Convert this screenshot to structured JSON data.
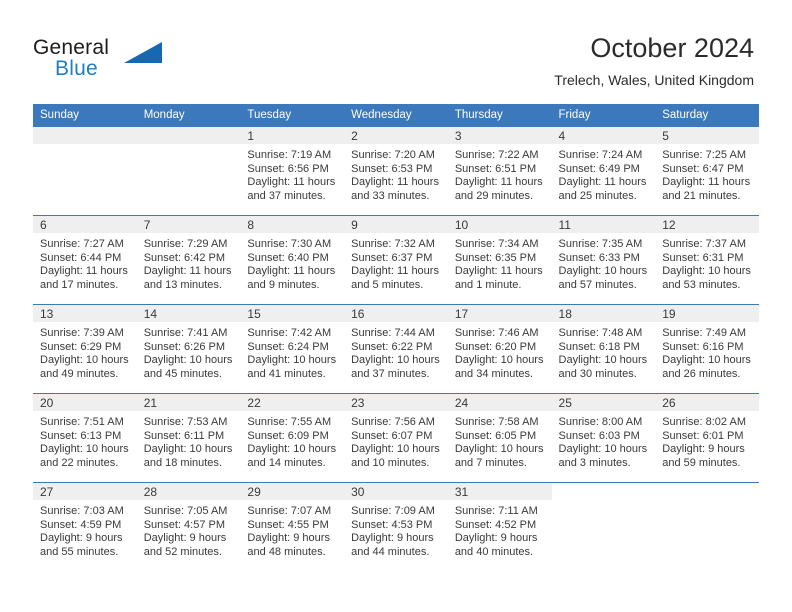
{
  "brand": {
    "name_part1": "General",
    "name_part2": "Blue",
    "logo_icon": "triangle-flag-icon",
    "accent_color": "#1669b0"
  },
  "header": {
    "month_title": "October 2024",
    "location": "Trelech, Wales, United Kingdom"
  },
  "theme": {
    "header_blue": "#3b78bc",
    "day_band_gray": "#efefef",
    "text_color": "#3a3a3a"
  },
  "weekday_headers": [
    "Sunday",
    "Monday",
    "Tuesday",
    "Wednesday",
    "Thursday",
    "Friday",
    "Saturday"
  ],
  "labels": {
    "sunrise_prefix": "Sunrise:",
    "sunset_prefix": "Sunset:",
    "daylight_prefix": "Daylight:"
  },
  "weeks": [
    {
      "days": [
        {
          "empty": true
        },
        {
          "empty": true
        },
        {
          "day": "1",
          "sunrise": "Sunrise: 7:19 AM",
          "sunset": "Sunset: 6:56 PM",
          "daylight_l1": "Daylight: 11 hours",
          "daylight_l2": "and 37 minutes."
        },
        {
          "day": "2",
          "sunrise": "Sunrise: 7:20 AM",
          "sunset": "Sunset: 6:53 PM",
          "daylight_l1": "Daylight: 11 hours",
          "daylight_l2": "and 33 minutes."
        },
        {
          "day": "3",
          "sunrise": "Sunrise: 7:22 AM",
          "sunset": "Sunset: 6:51 PM",
          "daylight_l1": "Daylight: 11 hours",
          "daylight_l2": "and 29 minutes."
        },
        {
          "day": "4",
          "sunrise": "Sunrise: 7:24 AM",
          "sunset": "Sunset: 6:49 PM",
          "daylight_l1": "Daylight: 11 hours",
          "daylight_l2": "and 25 minutes."
        },
        {
          "day": "5",
          "sunrise": "Sunrise: 7:25 AM",
          "sunset": "Sunset: 6:47 PM",
          "daylight_l1": "Daylight: 11 hours",
          "daylight_l2": "and 21 minutes."
        }
      ]
    },
    {
      "days": [
        {
          "day": "6",
          "sunrise": "Sunrise: 7:27 AM",
          "sunset": "Sunset: 6:44 PM",
          "daylight_l1": "Daylight: 11 hours",
          "daylight_l2": "and 17 minutes."
        },
        {
          "day": "7",
          "sunrise": "Sunrise: 7:29 AM",
          "sunset": "Sunset: 6:42 PM",
          "daylight_l1": "Daylight: 11 hours",
          "daylight_l2": "and 13 minutes."
        },
        {
          "day": "8",
          "sunrise": "Sunrise: 7:30 AM",
          "sunset": "Sunset: 6:40 PM",
          "daylight_l1": "Daylight: 11 hours",
          "daylight_l2": "and 9 minutes."
        },
        {
          "day": "9",
          "sunrise": "Sunrise: 7:32 AM",
          "sunset": "Sunset: 6:37 PM",
          "daylight_l1": "Daylight: 11 hours",
          "daylight_l2": "and 5 minutes."
        },
        {
          "day": "10",
          "sunrise": "Sunrise: 7:34 AM",
          "sunset": "Sunset: 6:35 PM",
          "daylight_l1": "Daylight: 11 hours",
          "daylight_l2": "and 1 minute."
        },
        {
          "day": "11",
          "sunrise": "Sunrise: 7:35 AM",
          "sunset": "Sunset: 6:33 PM",
          "daylight_l1": "Daylight: 10 hours",
          "daylight_l2": "and 57 minutes."
        },
        {
          "day": "12",
          "sunrise": "Sunrise: 7:37 AM",
          "sunset": "Sunset: 6:31 PM",
          "daylight_l1": "Daylight: 10 hours",
          "daylight_l2": "and 53 minutes."
        }
      ]
    },
    {
      "days": [
        {
          "day": "13",
          "sunrise": "Sunrise: 7:39 AM",
          "sunset": "Sunset: 6:29 PM",
          "daylight_l1": "Daylight: 10 hours",
          "daylight_l2": "and 49 minutes."
        },
        {
          "day": "14",
          "sunrise": "Sunrise: 7:41 AM",
          "sunset": "Sunset: 6:26 PM",
          "daylight_l1": "Daylight: 10 hours",
          "daylight_l2": "and 45 minutes."
        },
        {
          "day": "15",
          "sunrise": "Sunrise: 7:42 AM",
          "sunset": "Sunset: 6:24 PM",
          "daylight_l1": "Daylight: 10 hours",
          "daylight_l2": "and 41 minutes."
        },
        {
          "day": "16",
          "sunrise": "Sunrise: 7:44 AM",
          "sunset": "Sunset: 6:22 PM",
          "daylight_l1": "Daylight: 10 hours",
          "daylight_l2": "and 37 minutes."
        },
        {
          "day": "17",
          "sunrise": "Sunrise: 7:46 AM",
          "sunset": "Sunset: 6:20 PM",
          "daylight_l1": "Daylight: 10 hours",
          "daylight_l2": "and 34 minutes."
        },
        {
          "day": "18",
          "sunrise": "Sunrise: 7:48 AM",
          "sunset": "Sunset: 6:18 PM",
          "daylight_l1": "Daylight: 10 hours",
          "daylight_l2": "and 30 minutes."
        },
        {
          "day": "19",
          "sunrise": "Sunrise: 7:49 AM",
          "sunset": "Sunset: 6:16 PM",
          "daylight_l1": "Daylight: 10 hours",
          "daylight_l2": "and 26 minutes."
        }
      ]
    },
    {
      "days": [
        {
          "day": "20",
          "sunrise": "Sunrise: 7:51 AM",
          "sunset": "Sunset: 6:13 PM",
          "daylight_l1": "Daylight: 10 hours",
          "daylight_l2": "and 22 minutes."
        },
        {
          "day": "21",
          "sunrise": "Sunrise: 7:53 AM",
          "sunset": "Sunset: 6:11 PM",
          "daylight_l1": "Daylight: 10 hours",
          "daylight_l2": "and 18 minutes."
        },
        {
          "day": "22",
          "sunrise": "Sunrise: 7:55 AM",
          "sunset": "Sunset: 6:09 PM",
          "daylight_l1": "Daylight: 10 hours",
          "daylight_l2": "and 14 minutes."
        },
        {
          "day": "23",
          "sunrise": "Sunrise: 7:56 AM",
          "sunset": "Sunset: 6:07 PM",
          "daylight_l1": "Daylight: 10 hours",
          "daylight_l2": "and 10 minutes."
        },
        {
          "day": "24",
          "sunrise": "Sunrise: 7:58 AM",
          "sunset": "Sunset: 6:05 PM",
          "daylight_l1": "Daylight: 10 hours",
          "daylight_l2": "and 7 minutes."
        },
        {
          "day": "25",
          "sunrise": "Sunrise: 8:00 AM",
          "sunset": "Sunset: 6:03 PM",
          "daylight_l1": "Daylight: 10 hours",
          "daylight_l2": "and 3 minutes."
        },
        {
          "day": "26",
          "sunrise": "Sunrise: 8:02 AM",
          "sunset": "Sunset: 6:01 PM",
          "daylight_l1": "Daylight: 9 hours",
          "daylight_l2": "and 59 minutes."
        }
      ]
    },
    {
      "days": [
        {
          "day": "27",
          "sunrise": "Sunrise: 7:03 AM",
          "sunset": "Sunset: 4:59 PM",
          "daylight_l1": "Daylight: 9 hours",
          "daylight_l2": "and 55 minutes."
        },
        {
          "day": "28",
          "sunrise": "Sunrise: 7:05 AM",
          "sunset": "Sunset: 4:57 PM",
          "daylight_l1": "Daylight: 9 hours",
          "daylight_l2": "and 52 minutes."
        },
        {
          "day": "29",
          "sunrise": "Sunrise: 7:07 AM",
          "sunset": "Sunset: 4:55 PM",
          "daylight_l1": "Daylight: 9 hours",
          "daylight_l2": "and 48 minutes."
        },
        {
          "day": "30",
          "sunrise": "Sunrise: 7:09 AM",
          "sunset": "Sunset: 4:53 PM",
          "daylight_l1": "Daylight: 9 hours",
          "daylight_l2": "and 44 minutes."
        },
        {
          "day": "31",
          "sunrise": "Sunrise: 7:11 AM",
          "sunset": "Sunset: 4:52 PM",
          "daylight_l1": "Daylight: 9 hours",
          "daylight_l2": "and 40 minutes."
        },
        {
          "blank": true
        },
        {
          "blank": true
        }
      ]
    }
  ]
}
